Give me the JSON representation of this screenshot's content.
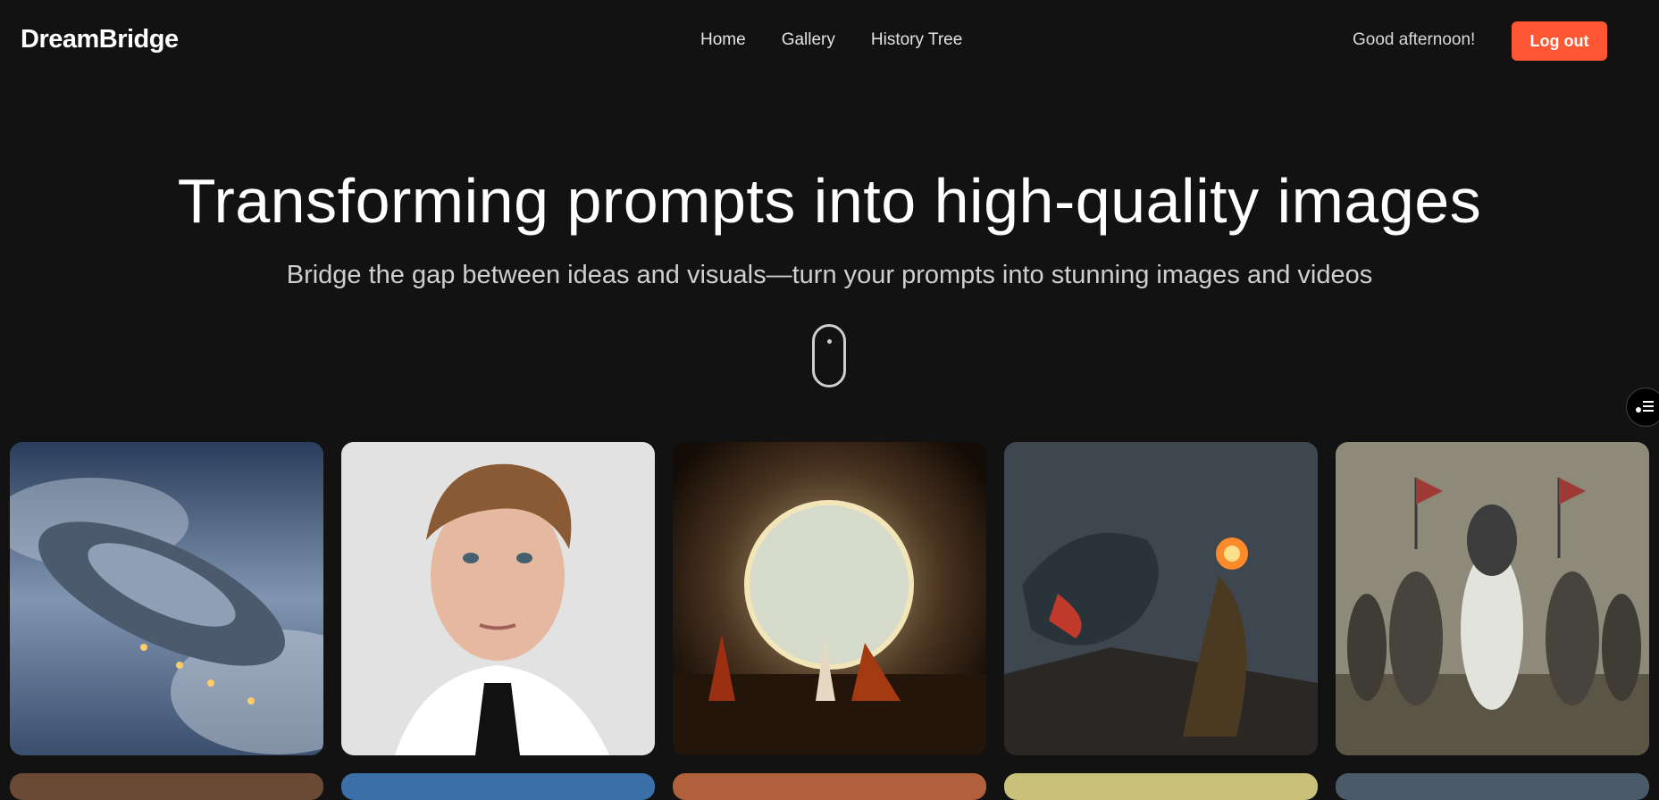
{
  "header": {
    "logo": "DreamBridge",
    "nav": [
      "Home",
      "Gallery",
      "History Tree"
    ],
    "greeting": "Good afternoon!",
    "logout_label": "Log out"
  },
  "hero": {
    "title": "Transforming prompts into high-quality images",
    "subtitle": "Bridge the gap between ideas and visuals—turn your prompts into stunning images and videos"
  },
  "gallery": {
    "items": [
      {
        "subject": "spaceship-in-clouds"
      },
      {
        "subject": "young-man-portrait"
      },
      {
        "subject": "glowing-portal-hall"
      },
      {
        "subject": "dragon-and-mage"
      },
      {
        "subject": "armored-knights-on-horseback"
      }
    ]
  },
  "icons": {
    "scroll": "mouse-scroll-icon",
    "side_panel": "settings-list-icon"
  },
  "colors": {
    "background": "#121212",
    "accent": "#ff5733"
  }
}
